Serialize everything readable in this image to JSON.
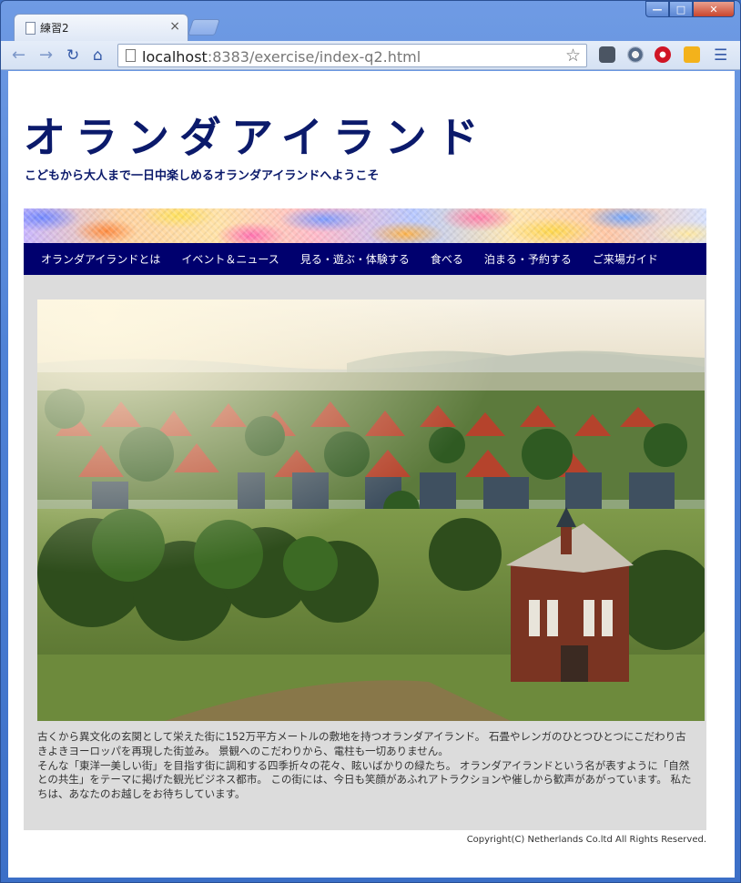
{
  "browser": {
    "tab_title": "練習2",
    "tab_close": "×",
    "url_host": "localhost",
    "url_path": ":8383/exercise/index-q2.html",
    "window_controls": {
      "minimize": "—",
      "maximize": "□",
      "close": "✕"
    },
    "nav_icons": {
      "back": "back-arrow-icon",
      "forward": "forward-arrow-icon",
      "reload": "reload-icon",
      "home": "home-icon",
      "star": "bookmark-star-icon",
      "menu": "menu-icon"
    }
  },
  "header": {
    "title": "オランダアイランド",
    "subtitle": "こどもから大人まで一日中楽しめるオランダアイランドへようこそ"
  },
  "nav": {
    "items": [
      "オランダアイランドとは",
      "イベント＆ニュース",
      "見る・遊ぶ・体験する",
      "食べる",
      "泊まる・予約する",
      "ご来場ガイド"
    ]
  },
  "main": {
    "paragraph1": "古くから異文化の玄関として栄えた街に152万平方メートルの敷地を持つオランダアイランド。 石畳やレンガのひとつひとつにこだわり古きよきヨーロッパを再現した街並み。 景観へのこだわりから、電柱も一切ありません。",
    "paragraph2": "そんな「東洋一美しい街」を目指す街に調和する四季折々の花々、眩いばかりの緑たち。 オランダアイランドという名が表すように「自然との共生」をテーマに掲げた観光ビジネス都市。 この街には、今日も笑顔があふれアトラクションや催しから歓声があがっています。 私たちは、あなたのお越しをお待ちしています。"
  },
  "footer": {
    "copyright": "Copyright(C) Netherlands Co.ltd All Rights Reserved."
  },
  "colors": {
    "title": "#0b1a6b",
    "nav_bg": "#00006e",
    "content_bg": "#dcdcdc"
  }
}
